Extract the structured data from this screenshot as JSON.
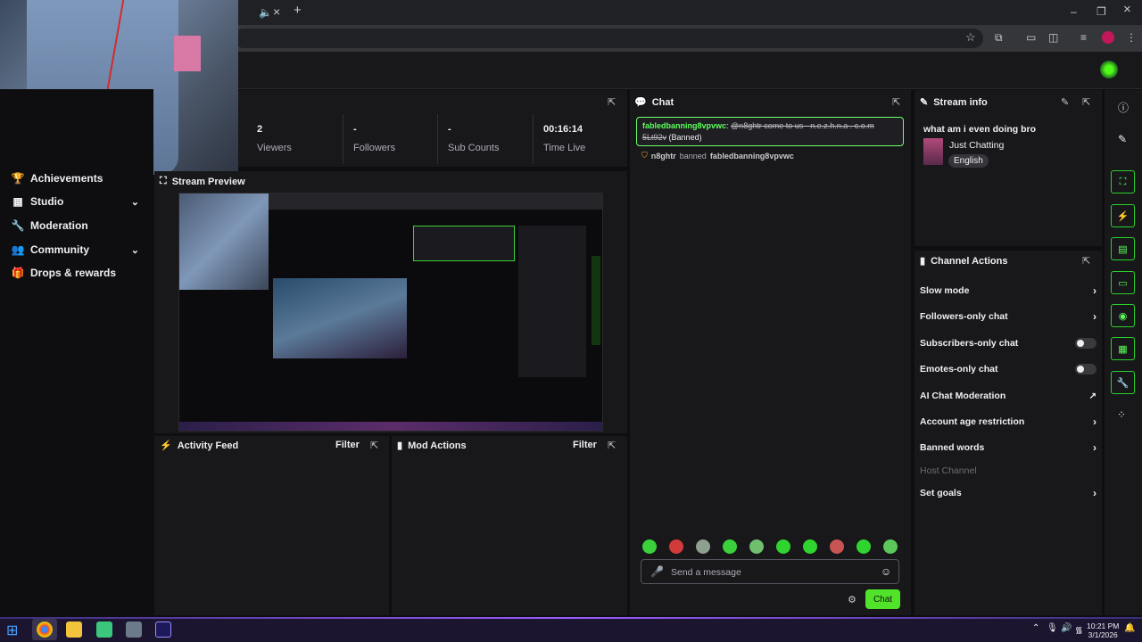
{
  "browser": {
    "tab_audio_icon": "speaker-icon",
    "tab_close": "×",
    "new_tab": "+",
    "win_min": "–",
    "win_max": "❐",
    "win_close": "×"
  },
  "sidebar": {
    "items": [
      {
        "label": "Achievements",
        "icon": "trophy-icon"
      },
      {
        "label": "Studio",
        "icon": "studio-icon",
        "expandable": true
      },
      {
        "label": "Moderation",
        "icon": "wrench-icon"
      },
      {
        "label": "Community",
        "icon": "people-icon",
        "expandable": true
      },
      {
        "label": "Drops & rewards",
        "icon": "drops-icon"
      }
    ]
  },
  "stats": [
    {
      "value": "2",
      "label": "Viewers"
    },
    {
      "value": "-",
      "label": "Followers"
    },
    {
      "value": "-",
      "label": "Sub Counts"
    },
    {
      "value": "00:16:14",
      "label": "Time Live"
    }
  ],
  "stream_preview": {
    "title": "Stream Preview"
  },
  "activity_feed": {
    "title": "Activity Feed",
    "filter": "Filter"
  },
  "mod_actions": {
    "title": "Mod Actions",
    "filter": "Filter"
  },
  "chat": {
    "title": "Chat",
    "message_user": "fabledbanning8vpvwc",
    "message_text": "@n8ghtr come to us - n.e.z.h.n.a . c.o.m 5Lt92v",
    "message_status": "(Banned)",
    "ban_actor": "n8ghtr",
    "ban_verb": "banned",
    "ban_target": "fabledbanning8vpvwc",
    "input_placeholder": "Send a message",
    "chat_button": "Chat"
  },
  "stream_info": {
    "title": "Stream info",
    "stream_title": "what am i even doing bro",
    "category": "Just Chatting",
    "tag": "English"
  },
  "channel_actions": {
    "title": "Channel Actions",
    "items": [
      {
        "label": "Slow mode",
        "control": "chevron"
      },
      {
        "label": "Followers-only chat",
        "control": "chevron"
      },
      {
        "label": "Subscribers-only chat",
        "control": "toggle"
      },
      {
        "label": "Emotes-only chat",
        "control": "toggle"
      },
      {
        "label": "AI Chat Moderation",
        "control": "external"
      },
      {
        "label": "Account age restriction",
        "control": "chevron"
      },
      {
        "label": "Banned words",
        "control": "chevron"
      },
      {
        "label": "Host Channel",
        "control": "none",
        "disabled": true
      },
      {
        "label": "Set goals",
        "control": "chevron"
      }
    ]
  },
  "taskbar": {
    "time": "10:21 PM",
    "date": "3/1/2026"
  },
  "colors": {
    "accent": "#53fc18",
    "panel": "#18181b",
    "bg": "#0e0e10"
  }
}
